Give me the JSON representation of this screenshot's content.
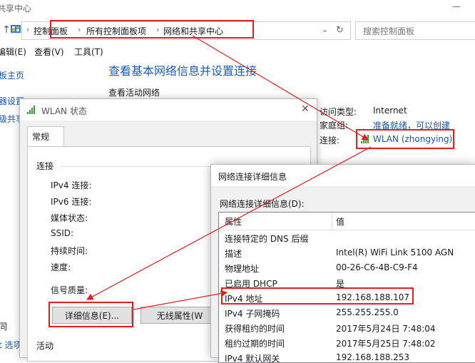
{
  "window": {
    "title": "共享中心"
  },
  "address": {
    "crumbs": [
      "控制面板",
      "所有控制面板项",
      "网络和共享中心"
    ],
    "search_placeholder": "搜索控制面板"
  },
  "menu": {
    "items": [
      "编辑(E)",
      "查看(V)",
      "工具(T)"
    ]
  },
  "sidebar": {
    "items": [
      "板主页",
      "器设置",
      "级共享",
      "同",
      "t 选项"
    ]
  },
  "main": {
    "heading": "查看基本网络信息并设置连接",
    "active_networks": "查看活动网络",
    "access_type_label": "访问类型:",
    "access_type_value": "Internet",
    "homegroup_label": "家庭组:",
    "homegroup_value": "准备就绪，可以创建",
    "connection_label": "连接:",
    "connection_value": "WLAN (zhongying)"
  },
  "wlan_dialog": {
    "title": "WLAN 状态",
    "tab_general": "常规",
    "group_connection": "连接",
    "rows": [
      "IPv4 连接:",
      "IPv6 连接:",
      "媒体状态:",
      "SSID:",
      "持续时间:",
      "速度:"
    ],
    "signal_quality": "信号质量:",
    "details_button": "详细信息(E)...",
    "wireless_props_button": "无线属性(W",
    "group_activity": "活动"
  },
  "detail_dialog": {
    "title": "网络连接详细信息",
    "caption": "网络连接详细信息(D):",
    "col_property": "属性",
    "col_value": "值",
    "rows": [
      {
        "prop": "连接特定的 DNS 后缀",
        "value": ""
      },
      {
        "prop": "描述",
        "value": "Intel(R) WiFi Link 5100 AGN"
      },
      {
        "prop": "物理地址",
        "value": "00-26-C6-4B-C9-F4"
      },
      {
        "prop": "已启用 DHCP",
        "value": "是"
      },
      {
        "prop": "IPv4 地址",
        "value": "192.168.188.107"
      },
      {
        "prop": "IPv4 子网掩码",
        "value": "255.255.255.0"
      },
      {
        "prop": "获得租约的时间",
        "value": "2017年5月24日 7:48:04"
      },
      {
        "prop": "租约过期的时间",
        "value": "2017年5月25日 7:48:02"
      },
      {
        "prop": "IPv4 默认网关",
        "value": "192.168.188.253"
      }
    ]
  },
  "colors": {
    "annotation_red": "#e02020",
    "link_blue": "#1a56a8",
    "heading_blue": "#1a5fb4"
  }
}
